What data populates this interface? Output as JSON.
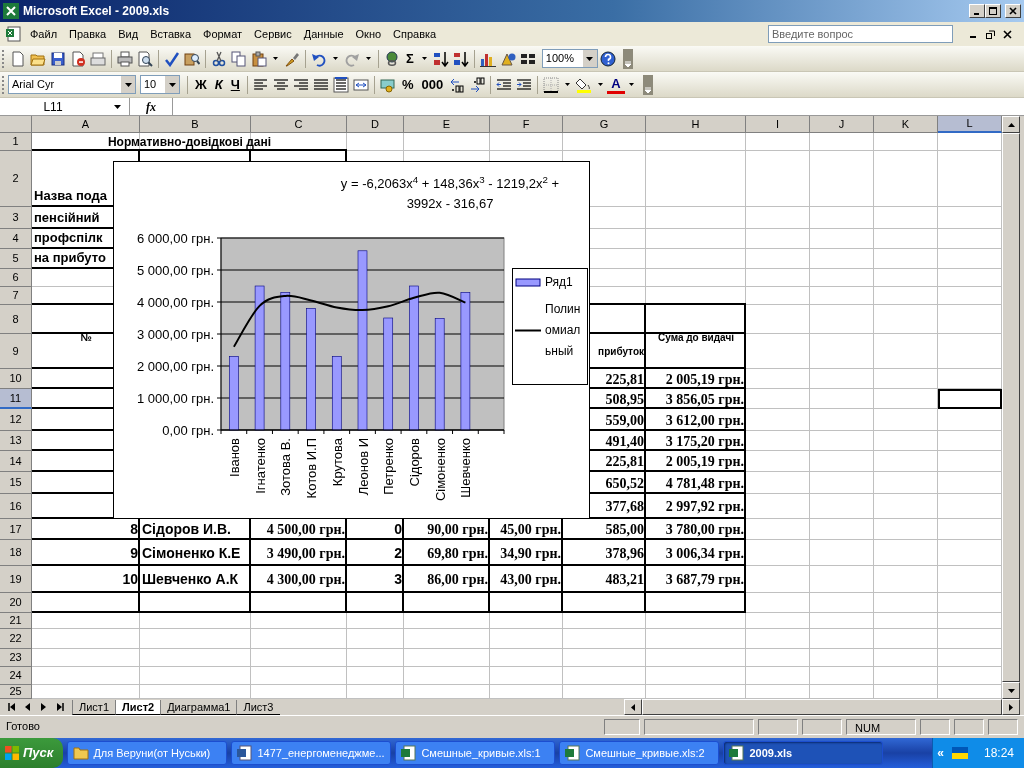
{
  "window": {
    "title": "Microsoft Excel - 2009.xls"
  },
  "menu": [
    "Файл",
    "Правка",
    "Вид",
    "Вставка",
    "Формат",
    "Сервис",
    "Данные",
    "Окно",
    "Справка"
  ],
  "help_box": {
    "placeholder": "Введите вопрос"
  },
  "toolbar": {
    "sum": "Σ",
    "zoom": "100%"
  },
  "format_bar": {
    "font": "Arial Cyr",
    "size": "10",
    "bold": "Ж",
    "italic": "К",
    "underline": "Ч",
    "percent": "%",
    "thousands": "000",
    "font_color": "A"
  },
  "formula_bar": {
    "name_box": "L11",
    "fx": "fx"
  },
  "sheet": {
    "columns": [
      {
        "label": "A",
        "selected": false
      },
      {
        "label": "B",
        "selected": false
      },
      {
        "label": "C",
        "selected": false
      },
      {
        "label": "D",
        "selected": false
      },
      {
        "label": "E",
        "selected": false
      },
      {
        "label": "F",
        "selected": false
      },
      {
        "label": "G",
        "selected": false
      },
      {
        "label": "H",
        "selected": false
      },
      {
        "label": "I",
        "selected": false
      },
      {
        "label": "J",
        "selected": false
      },
      {
        "label": "K",
        "selected": false
      },
      {
        "label": "L",
        "selected": true
      }
    ],
    "rows": [
      {
        "label": "1",
        "selected": false,
        "cells": {
          "A": {
            "text": "Нормативно-довідкові дані",
            "kind": "title"
          }
        }
      },
      {
        "label": "2",
        "selected": false,
        "cells": {
          "A": {
            "text": "Назва пода",
            "kind": "label"
          }
        }
      },
      {
        "label": "3",
        "selected": false,
        "cells": {
          "A": {
            "text": "пенсійний",
            "kind": "label"
          }
        }
      },
      {
        "label": "4",
        "selected": false,
        "cells": {
          "A": {
            "text": "профспілк",
            "kind": "label"
          }
        }
      },
      {
        "label": "5",
        "selected": false,
        "cells": {
          "A": {
            "text": "на прибуто",
            "kind": "label"
          }
        }
      },
      {
        "label": "6",
        "selected": false
      },
      {
        "label": "7",
        "selected": false
      },
      {
        "label": "8",
        "selected": false,
        "cells": {
          "A": {
            "text": "№",
            "kind": "header"
          },
          "H": {
            "text": "Сума до видачі",
            "kind": "header"
          }
        }
      },
      {
        "label": "9",
        "selected": false,
        "cells": {
          "G": {
            "text": "прибуток",
            "kind": "subheader"
          }
        }
      },
      {
        "label": "10",
        "selected": false,
        "cells": {
          "G": {
            "text": "225,81",
            "kind": "num"
          },
          "H": {
            "text": "2 005,19 грн.",
            "kind": "num"
          }
        }
      },
      {
        "label": "11",
        "selected": true,
        "cells": {
          "G": {
            "text": "508,95",
            "kind": "num"
          },
          "H": {
            "text": "3 856,05 грн.",
            "kind": "num"
          }
        }
      },
      {
        "label": "12",
        "selected": false,
        "cells": {
          "G": {
            "text": "559,00",
            "kind": "num"
          },
          "H": {
            "text": "3 612,00 грн.",
            "kind": "num"
          }
        }
      },
      {
        "label": "13",
        "selected": false,
        "cells": {
          "G": {
            "text": "491,40",
            "kind": "num"
          },
          "H": {
            "text": "3 175,20 грн.",
            "kind": "num"
          }
        }
      },
      {
        "label": "14",
        "selected": false,
        "cells": {
          "G": {
            "text": "225,81",
            "kind": "num"
          },
          "H": {
            "text": "2 005,19 грн.",
            "kind": "num"
          }
        }
      },
      {
        "label": "15",
        "selected": false,
        "cells": {
          "G": {
            "text": "650,52",
            "kind": "num"
          },
          "H": {
            "text": "4 781,48 грн.",
            "kind": "num"
          }
        }
      },
      {
        "label": "16",
        "selected": false,
        "cells": {
          "G": {
            "text": "377,68",
            "kind": "num"
          },
          "H": {
            "text": "2 997,92 грн.",
            "kind": "num"
          }
        }
      },
      {
        "label": "17",
        "selected": false,
        "cells": {
          "A": {
            "text": "8",
            "kind": "int"
          },
          "B": {
            "text": "Сідоров И.В.",
            "kind": "name"
          },
          "C": {
            "text": "4 500,00 грн.",
            "kind": "num"
          },
          "D": {
            "text": "0",
            "kind": "int"
          },
          "E": {
            "text": "90,00 грн.",
            "kind": "num"
          },
          "F": {
            "text": "45,00 грн.",
            "kind": "num"
          },
          "G": {
            "text": "585,00",
            "kind": "num"
          },
          "H": {
            "text": "3 780,00 грн.",
            "kind": "num"
          }
        }
      },
      {
        "label": "18",
        "selected": false,
        "cells": {
          "A": {
            "text": "9",
            "kind": "int"
          },
          "B": {
            "text": "Сімоненко К.Е",
            "kind": "name"
          },
          "C": {
            "text": "3 490,00 грн.",
            "kind": "num"
          },
          "D": {
            "text": "2",
            "kind": "int"
          },
          "E": {
            "text": "69,80 грн.",
            "kind": "num"
          },
          "F": {
            "text": "34,90 грн.",
            "kind": "num"
          },
          "G": {
            "text": "378,96",
            "kind": "num"
          },
          "H": {
            "text": "3 006,34 грн.",
            "kind": "num"
          }
        }
      },
      {
        "label": "19",
        "selected": false,
        "cells": {
          "A": {
            "text": "10",
            "kind": "int"
          },
          "B": {
            "text": "Шевченко А.К",
            "kind": "name"
          },
          "C": {
            "text": "4 300,00 грн.",
            "kind": "num"
          },
          "D": {
            "text": "3",
            "kind": "int"
          },
          "E": {
            "text": "86,00 грн.",
            "kind": "num"
          },
          "F": {
            "text": "43,00 грн.",
            "kind": "num"
          },
          "G": {
            "text": "483,21",
            "kind": "num"
          },
          "H": {
            "text": "3 687,79 грн.",
            "kind": "num"
          }
        }
      },
      {
        "label": "20",
        "selected": false
      },
      {
        "label": "21",
        "selected": false
      },
      {
        "label": "22",
        "selected": false
      },
      {
        "label": "23",
        "selected": false
      },
      {
        "label": "24",
        "selected": false
      },
      {
        "label": "25",
        "selected": false
      }
    ]
  },
  "chart": {
    "chart_data": {
      "type": "bar",
      "categories": [
        "Іванов",
        "Ігнатенко",
        "Зотова В.",
        "Котов И.П",
        "Крутова",
        "Леонов И",
        "Петренко",
        "Сідоров",
        "Сімоненко",
        "Шевченко"
      ],
      "series": [
        {
          "name": "Ряд1",
          "color": "#9999ff",
          "values": [
            2300,
            4500,
            4300,
            3800,
            2300,
            5600,
            3500,
            4500,
            3490,
            4300
          ]
        },
        {
          "name": "Полиномиальный",
          "color": "#000000",
          "type": "line",
          "values": [
            2600,
            3880,
            4190,
            4050,
            3830,
            3750,
            3870,
            4130,
            4290,
            3980
          ]
        }
      ],
      "ylim": [
        0,
        6000
      ],
      "grid": true,
      "legend": true,
      "yticks": [
        {
          "value": 0,
          "label": "0,00 грн."
        },
        {
          "value": 1000,
          "label": "1 000,00 грн."
        },
        {
          "value": 2000,
          "label": "2 000,00 грн."
        },
        {
          "value": 3000,
          "label": "3 000,00 грн."
        },
        {
          "value": 4000,
          "label": "4 000,00 грн."
        },
        {
          "value": 5000,
          "label": "5 000,00 грн."
        },
        {
          "value": 6000,
          "label": "6 000,00 грн."
        }
      ],
      "annotations": [
        "y = -6,2063x$^{4}$ + 148,36x$^{3}$ - 1219,2x$^{2}$ + 3992x - 316,67"
      ]
    }
  },
  "sheet_tabs": [
    {
      "label": "Лист1",
      "selected": false
    },
    {
      "label": "Лист2",
      "selected": true
    },
    {
      "label": "Диаграмма1",
      "selected": false
    },
    {
      "label": "Лист3",
      "selected": false
    }
  ],
  "status_bar": {
    "text": "Готово",
    "num": "NUM"
  },
  "taskbar": {
    "start": "Пуск",
    "items": [
      {
        "label": "Для Веруни(от Нуськи)",
        "kind": "folder",
        "selected": false
      },
      {
        "label": "1477_енергоменеджме...",
        "kind": "word",
        "selected": false
      },
      {
        "label": "Смешные_кривые.xls:1",
        "kind": "excel",
        "selected": false
      },
      {
        "label": "Смешные_кривые.xls:2",
        "kind": "excel",
        "selected": false
      },
      {
        "label": "2009.xls",
        "kind": "excel",
        "selected": true
      }
    ],
    "tray_toggle": "«",
    "clock": "18:24"
  }
}
